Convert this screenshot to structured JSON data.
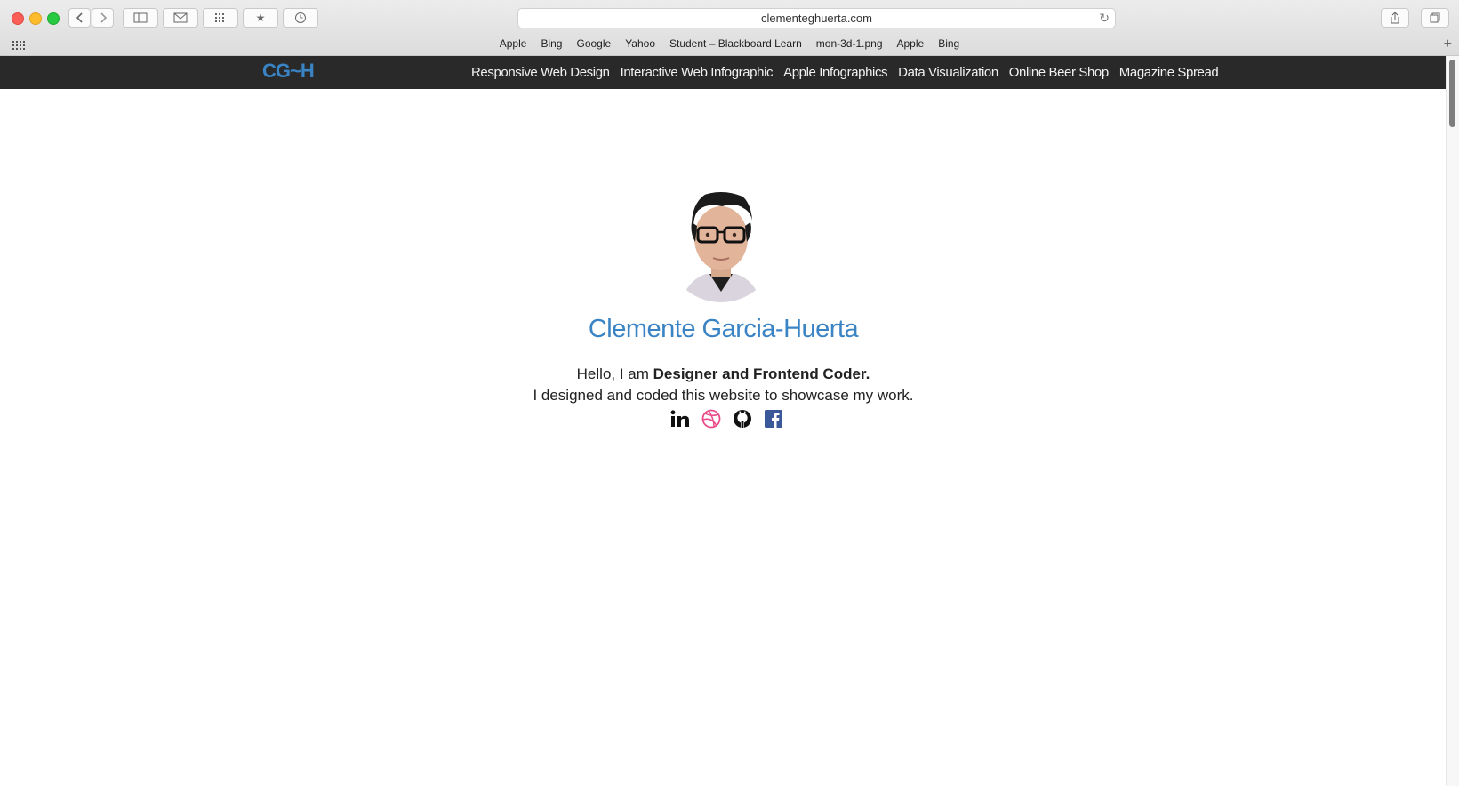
{
  "browser": {
    "url": "clementeghuerta.com",
    "bookmarks": [
      "Apple",
      "Bing",
      "Google",
      "Yahoo",
      "Student – Blackboard Learn",
      "mon-3d-1.png",
      "Apple",
      "Bing"
    ]
  },
  "site": {
    "logo": "CG~H",
    "nav": [
      "Responsive Web Design",
      "Interactive Web Infographic",
      "Apple Infographics",
      "Data Visualization",
      "Online Beer Shop",
      "Magazine Spread"
    ],
    "name": "Clemente Garcia-Huerta",
    "greeting_prefix": "Hello, I am ",
    "greeting_bold": "Designer and Frontend Coder.",
    "subline": "I designed and coded this website to showcase my work.",
    "social": [
      "linkedin-icon",
      "dribbble-icon",
      "github-icon",
      "facebook-icon"
    ],
    "accent_color": "#3a83c4",
    "nav_bg": "#292929"
  }
}
